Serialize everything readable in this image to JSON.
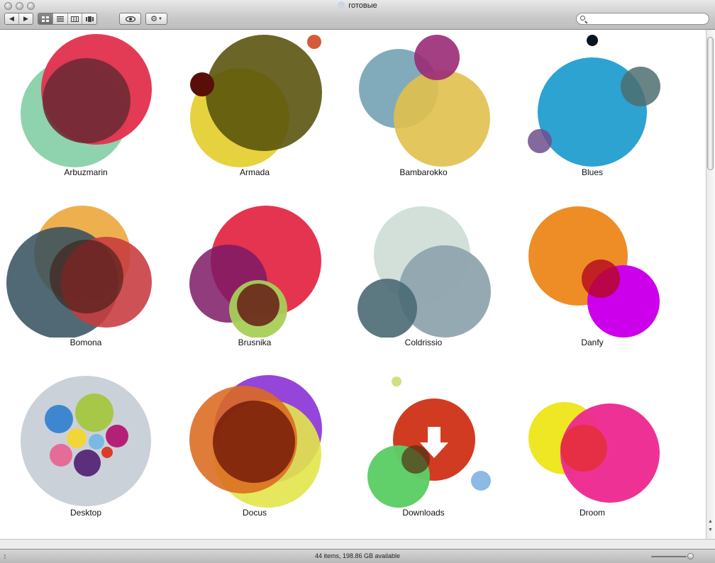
{
  "window": {
    "title": "готовые"
  },
  "toolbar": {
    "back": "◀",
    "forward": "▶",
    "view_modes": [
      "icon-view",
      "list-view",
      "column-view",
      "coverflow-view"
    ],
    "search_placeholder": ""
  },
  "items": [
    {
      "label": "Arbuzmarin"
    },
    {
      "label": "Armada"
    },
    {
      "label": "Bambarokko"
    },
    {
      "label": "Blues"
    },
    {
      "label": "Bomona"
    },
    {
      "label": "Brusnika"
    },
    {
      "label": "Coldrissio"
    },
    {
      "label": "Danfy"
    },
    {
      "label": "Desktop"
    },
    {
      "label": "Docus"
    },
    {
      "label": "Downloads"
    },
    {
      "label": "Droom"
    }
  ],
  "status": {
    "text": "44 items, 198.86 GB available"
  }
}
